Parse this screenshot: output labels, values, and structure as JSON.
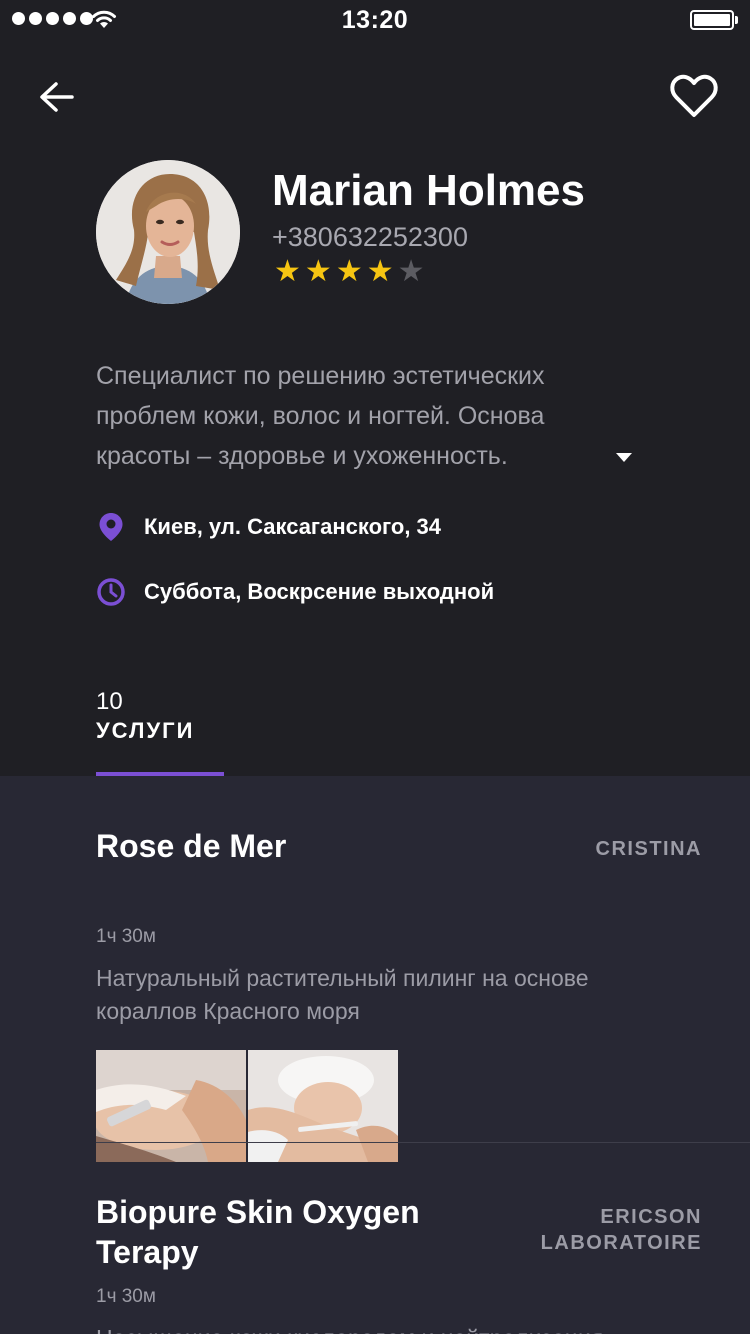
{
  "status_bar": {
    "time": "13:20",
    "signal_dots": 5
  },
  "profile": {
    "name": "Marian Holmes",
    "phone": "+380632252300",
    "rating": 4,
    "rating_max": 5,
    "description": "Специалист по решению эстетических проблем кожи, волос и ногтей. Основа красоты – здоровье и ухоженность.",
    "address": "Киев, ул. Саксаганского, 34",
    "schedule": "Суббота, Воскрсение выходной"
  },
  "icons": {
    "back": "arrow-left-icon",
    "favorite": "heart-outline-icon",
    "location": "location-pin-icon",
    "clock": "clock-icon",
    "expand": "caret-down-icon"
  },
  "tabs": [
    {
      "count": "10",
      "label": "УСЛУГИ",
      "active": true
    }
  ],
  "services": [
    {
      "title": "Rose de Mer",
      "brand": "CRISTINA",
      "duration": "1ч 30м",
      "description": "Натуральный растительный пилинг на основе кораллов Красного моря"
    },
    {
      "title": "Biopure Skin Oxygen Terapy",
      "brand": "ERICSON LABORATOIRE",
      "duration": "1ч 30м",
      "description": "Насыщение кожи кислородом и нейтрализация"
    }
  ],
  "colors": {
    "background": "#1f1f24",
    "list_background": "#282834",
    "accent": "#7b4fd4",
    "star_active": "#f6c512",
    "star_inactive": "#5c5c62"
  }
}
